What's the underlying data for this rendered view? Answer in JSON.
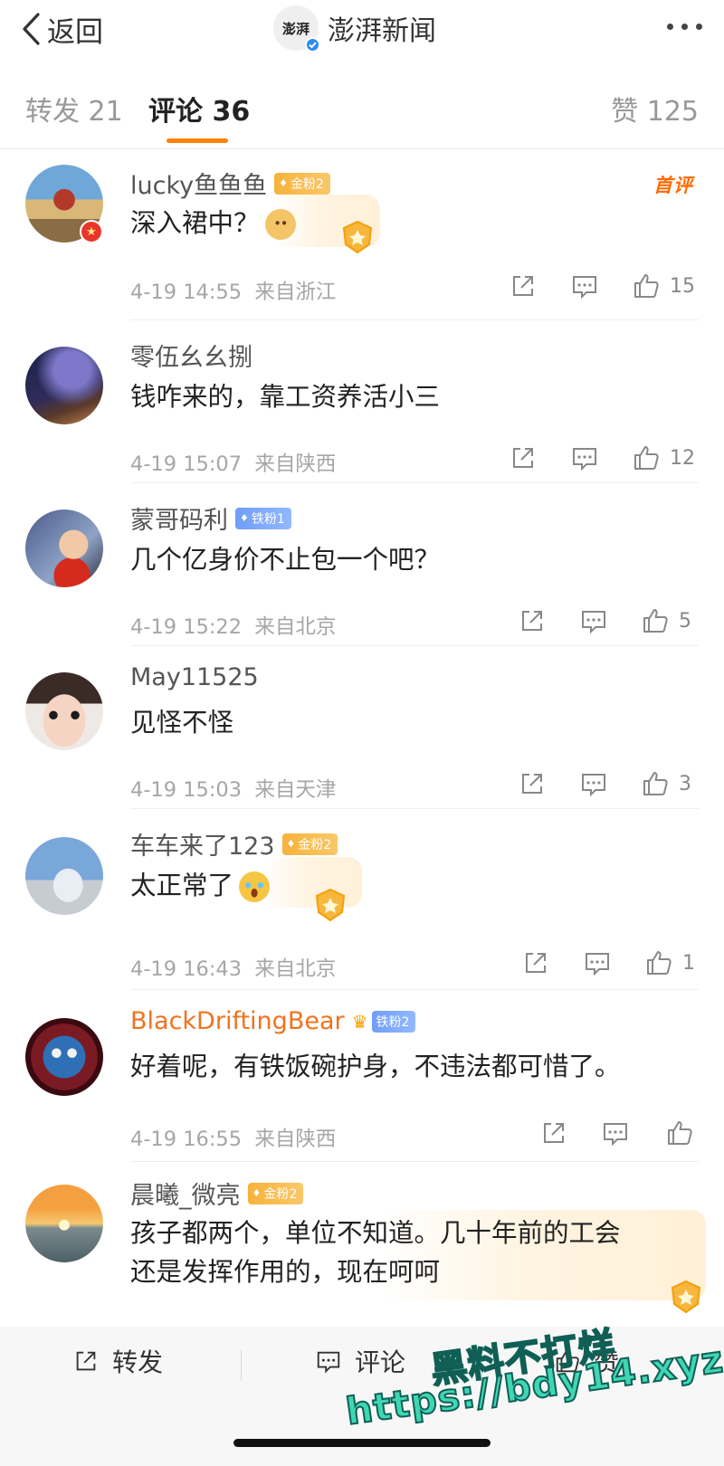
{
  "header": {
    "back_label": "返回",
    "account_name": "澎湃新闻",
    "logo_text": "澎湃"
  },
  "tabs": {
    "repost": "转发 21",
    "comment": "评论 36",
    "like": "赞 125"
  },
  "comments": [
    {
      "user": "lucky鱼鱼鱼",
      "fan_badge": "金粉2",
      "text": "深入裙中？",
      "first_label": "首评",
      "time": "4-19 14:55",
      "location": "来自浙江",
      "likes": "15"
    },
    {
      "user": "零伍幺幺捌",
      "text": "钱咋来的，靠工资养活小三",
      "time": "4-19 15:07",
      "location": "来自陕西",
      "likes": "12"
    },
    {
      "user": "蒙哥码利",
      "fan_badge": "铁粉1",
      "text": "几个亿身价不止包一个吧？",
      "time": "4-19 15:22",
      "location": "来自北京",
      "likes": "5"
    },
    {
      "user": "May11525",
      "text": "见怪不怪",
      "time": "4-19 15:03",
      "location": "来自天津",
      "likes": "3"
    },
    {
      "user": "车车来了123",
      "fan_badge": "金粉2",
      "text": "太正常了",
      "time": "4-19 16:43",
      "location": "来自北京",
      "likes": "1"
    },
    {
      "user": "BlackDriftingBear",
      "fan_badge": "铁粉2",
      "text": "好着呢，有铁饭碗护身，不违法都可惜了。",
      "time": "4-19 16:55",
      "location": "来自陕西",
      "likes": ""
    },
    {
      "user": "晨曦_微亮",
      "fan_badge": "金粉2",
      "text_line1": "孩子都两个，单位不知道。几十年前的工会",
      "text_line2": "还是发挥作用的，现在呵呵"
    }
  ],
  "bottom": {
    "repost": "转发",
    "comment": "评论",
    "like": "赞"
  },
  "watermark": {
    "line1": "黑料不打烊",
    "line2": "https://bdy14.xyz"
  },
  "colors": {
    "accent": "#ff8200",
    "watermark": "#3fd6b4",
    "username_highlight": "#f0731e"
  }
}
